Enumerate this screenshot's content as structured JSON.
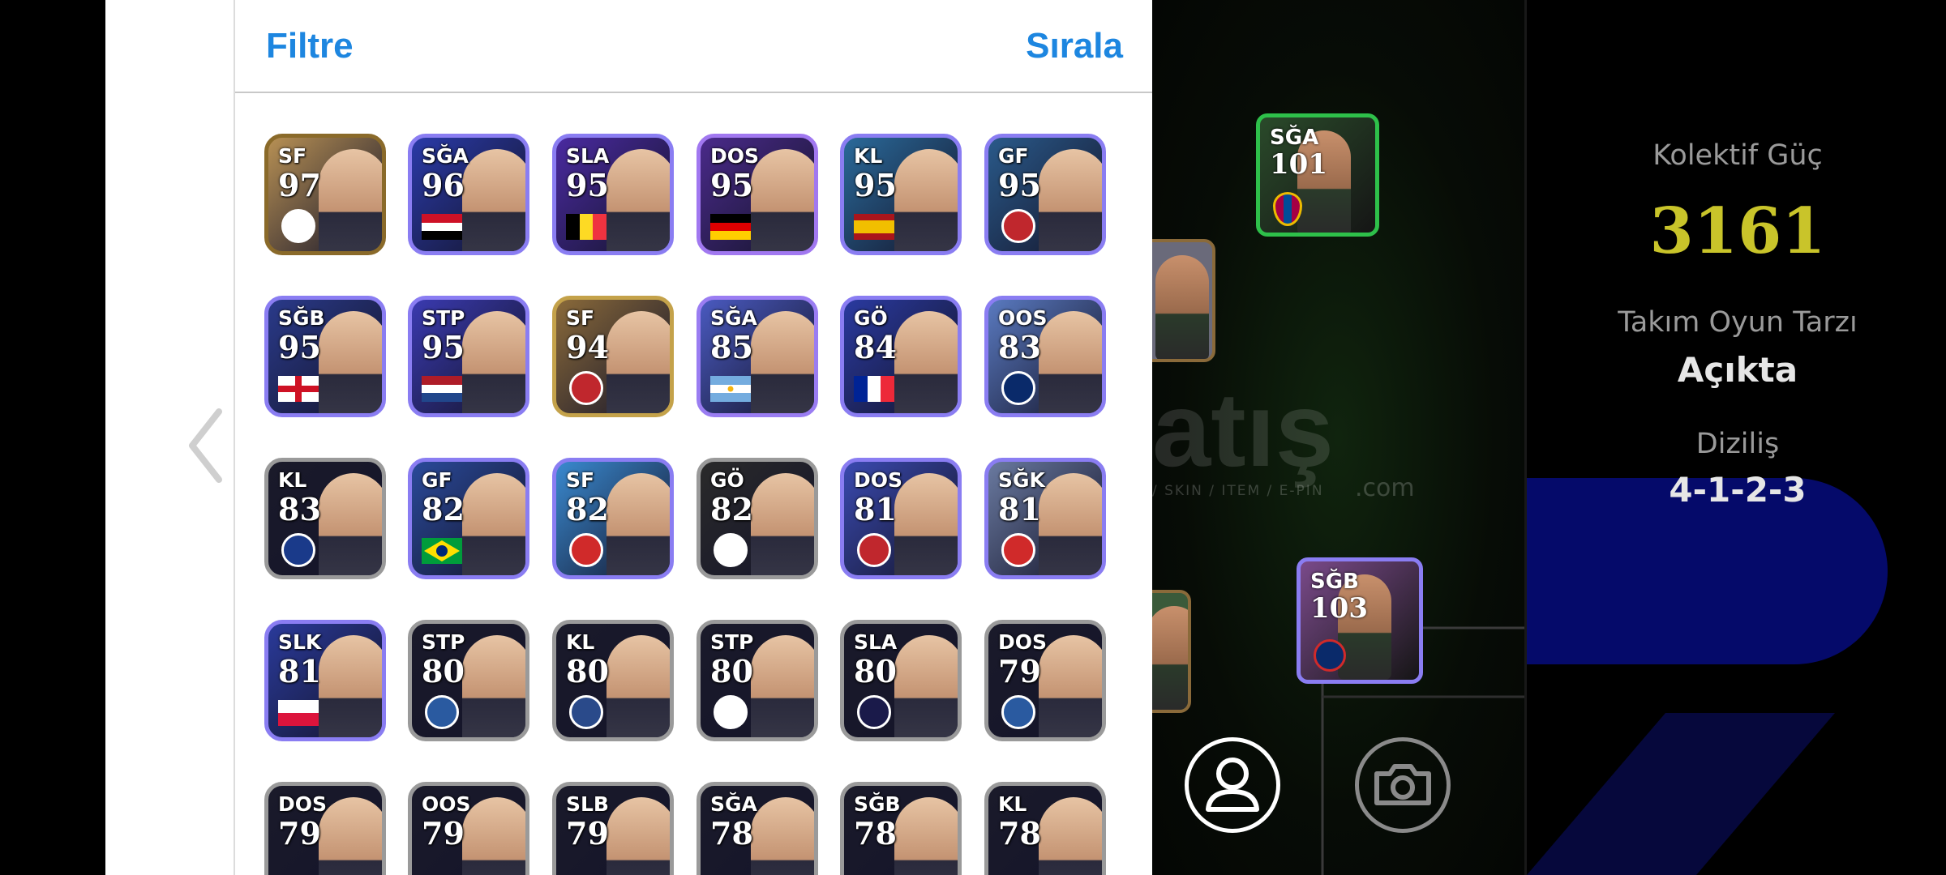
{
  "header": {
    "filter_label": "Filtre",
    "sort_label": "Sırala"
  },
  "player_cards": [
    {
      "pos": "SF",
      "rating": "97",
      "frame": "#8a6a2a",
      "bg": "#b79054",
      "flag": "none",
      "crest": "#ffffff"
    },
    {
      "pos": "SĞA",
      "rating": "96",
      "frame": "#8a7df2",
      "bg": "#2a3aa8",
      "flag": "egypt",
      "crest": ""
    },
    {
      "pos": "SLA",
      "rating": "95",
      "frame": "#8a7df2",
      "bg": "#4a2aa0",
      "flag": "belgium",
      "crest": ""
    },
    {
      "pos": "DOS",
      "rating": "95",
      "frame": "#a178f0",
      "bg": "#4a2a8a",
      "flag": "germany",
      "crest": ""
    },
    {
      "pos": "KL",
      "rating": "95",
      "frame": "#8a7df2",
      "bg": "#2a6a9a",
      "flag": "spain",
      "crest": ""
    },
    {
      "pos": "GF",
      "rating": "95",
      "frame": "#8a7df2",
      "bg": "#2a5a8a",
      "flag": "none",
      "crest": "#c0272d"
    },
    {
      "pos": "SĞB",
      "rating": "95",
      "frame": "#8a7df2",
      "bg": "#2a3a8a",
      "flag": "england",
      "crest": ""
    },
    {
      "pos": "STP",
      "rating": "95",
      "frame": "#8a7df2",
      "bg": "#3a3ab0",
      "flag": "netherlands",
      "crest": ""
    },
    {
      "pos": "SF",
      "rating": "94",
      "frame": "#c4a24a",
      "bg": "#8a6a3a",
      "flag": "none",
      "crest": "#c0272d"
    },
    {
      "pos": "SĞA",
      "rating": "85",
      "frame": "#9a7df2",
      "bg": "#4a5ac0",
      "flag": "argentina",
      "crest": ""
    },
    {
      "pos": "GÖ",
      "rating": "84",
      "frame": "#8a7df2",
      "bg": "#2a3aa0",
      "flag": "france",
      "crest": ""
    },
    {
      "pos": "OOS",
      "rating": "83",
      "frame": "#8a7df2",
      "bg": "#5a7ac0",
      "flag": "none",
      "crest": "#0a2a6a"
    },
    {
      "pos": "KL",
      "rating": "83",
      "frame": "#9a9a9a",
      "bg": "#1a1a2a",
      "flag": "none",
      "crest": "#1a3a8a"
    },
    {
      "pos": "GF",
      "rating": "82",
      "frame": "#8a7df2",
      "bg": "#2a4a9a",
      "flag": "brazil",
      "crest": ""
    },
    {
      "pos": "SF",
      "rating": "82",
      "frame": "#8a7df2",
      "bg": "#3a8ad0",
      "flag": "none",
      "crest": "#d02a2a"
    },
    {
      "pos": "GÖ",
      "rating": "82",
      "frame": "#9a9a9a",
      "bg": "#2a2a2a",
      "flag": "none",
      "crest": "#ffffff"
    },
    {
      "pos": "DOS",
      "rating": "81",
      "frame": "#8a7df2",
      "bg": "#3a4ab0",
      "flag": "none",
      "crest": "#c0272d"
    },
    {
      "pos": "SĞK",
      "rating": "81",
      "frame": "#8a7df2",
      "bg": "#6a7aa0",
      "flag": "none",
      "crest": "#d02a2a"
    },
    {
      "pos": "SLK",
      "rating": "81",
      "frame": "#8a7df2",
      "bg": "#2a3a9a",
      "flag": "poland",
      "crest": ""
    },
    {
      "pos": "STP",
      "rating": "80",
      "frame": "#9a9a9a",
      "bg": "#1a1a2a",
      "flag": "none",
      "crest": "#2a5aa0"
    },
    {
      "pos": "KL",
      "rating": "80",
      "frame": "#9a9a9a",
      "bg": "#1a1a2a",
      "flag": "none",
      "crest": "#2a4a8a"
    },
    {
      "pos": "STP",
      "rating": "80",
      "frame": "#9a9a9a",
      "bg": "#1a1a2a",
      "flag": "none",
      "crest": "#ffffff"
    },
    {
      "pos": "SLA",
      "rating": "80",
      "frame": "#9a9a9a",
      "bg": "#1a1a2a",
      "flag": "none",
      "crest": "#1a1a4a"
    },
    {
      "pos": "DOS",
      "rating": "79",
      "frame": "#9a9a9a",
      "bg": "#1a1a2a",
      "flag": "none",
      "crest": "#2a5aa0"
    },
    {
      "pos": "DOS",
      "rating": "79",
      "frame": "#9a9a9a",
      "bg": "#1a1a2a",
      "flag": "none",
      "crest": ""
    },
    {
      "pos": "OOS",
      "rating": "79",
      "frame": "#9a9a9a",
      "bg": "#1a1a2a",
      "flag": "none",
      "crest": ""
    },
    {
      "pos": "SLB",
      "rating": "79",
      "frame": "#9a9a9a",
      "bg": "#1a1a2a",
      "flag": "none",
      "crest": ""
    },
    {
      "pos": "SĞA",
      "rating": "78",
      "frame": "#9a9a9a",
      "bg": "#1a1a2a",
      "flag": "none",
      "crest": ""
    },
    {
      "pos": "SĞB",
      "rating": "78",
      "frame": "#9a9a9a",
      "bg": "#1a1a2a",
      "flag": "none",
      "crest": ""
    },
    {
      "pos": "KL",
      "rating": "78",
      "frame": "#9a9a9a",
      "bg": "#1a1a2a",
      "flag": "none",
      "crest": ""
    }
  ],
  "pitch": {
    "watermark": "atış",
    "watermark_sub": "/ SKIN / ITEM / E-PIN",
    "watermark_com": ".com",
    "cards": [
      {
        "pos": "SĞA",
        "rating": "101",
        "frame": "#2ec04a",
        "bg": "#2a4a2a"
      },
      {
        "pos": "SĞB",
        "rating": "103",
        "frame": "#8a7df2",
        "bg": "#7a4a8a"
      }
    ]
  },
  "team_stats": {
    "collective_label": "Kolektif Güç",
    "collective_value": "3161",
    "style_label": "Takım Oyun Tarzı",
    "style_value": "Açıkta",
    "formation_label": "Diziliş",
    "formation_value": "4-1-2-3"
  },
  "colors": {
    "accent_blue": "#1d86e0",
    "power_yellow": "#c9c42a"
  }
}
